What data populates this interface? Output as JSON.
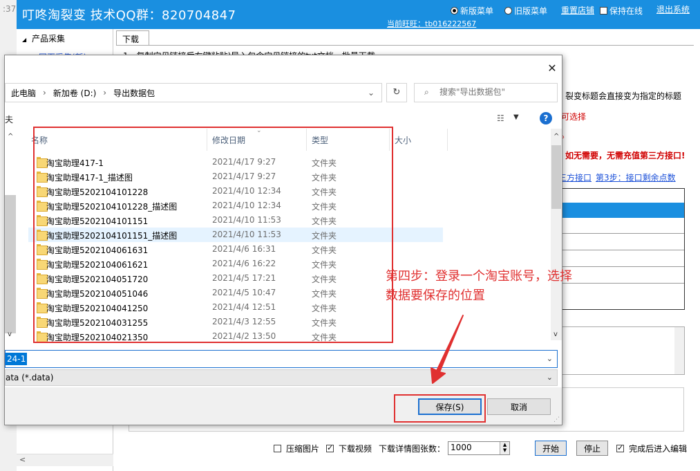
{
  "app": {
    "title": "叮咚淘裂变  技术QQ群：820704847",
    "left_edge_text": ":37",
    "menu_new": "新版菜单",
    "menu_old": "旧版菜单",
    "reset_shop": "重置店铺",
    "keep_online": "保持在线",
    "logout": "退出系统",
    "current_shop": "当前旺旺：tb016222567"
  },
  "sidebar": {
    "section": "产品采集",
    "link": "网页采集(新)"
  },
  "main": {
    "tab_label": "下载",
    "instruction": "1、复制宝贝链接后右键粘贴)导入包含宝贝链接的txt文档，批量下载",
    "hint_title": "裂变标题会直接变为指定的标题",
    "hint_select": "可选择",
    "hint_dot": "。",
    "hint_charge": "如无需要，无需充值第三方接口!",
    "step2_link": "三方接口",
    "step3_link": "第3步：接口剩余点数"
  },
  "bottom_bar": {
    "compress_label": "压缩图片",
    "video_label": "下载视频",
    "count_label": "下载详情图张数：",
    "count_value": "1000",
    "start_label": "开始",
    "stop_label": "停止",
    "edit_after_label": "完成后进入编辑"
  },
  "dialog": {
    "close_glyph": "✕",
    "breadcrumbs": [
      "此电脑",
      "新加卷 (D:)",
      "导出数据包"
    ],
    "search_placeholder": "搜索\"导出数据包\"",
    "toolbar_cut": "夫",
    "columns": {
      "name": "名称",
      "date": "修改日期",
      "type": "类型",
      "size": "大小"
    },
    "files": [
      {
        "name": "淘宝助理417-1",
        "date": "2021/4/17 9:27",
        "type": "文件夹"
      },
      {
        "name": "淘宝助理417-1_描述图",
        "date": "2021/4/17 9:27",
        "type": "文件夹"
      },
      {
        "name": "淘宝助理5202104101228",
        "date": "2021/4/10 12:34",
        "type": "文件夹"
      },
      {
        "name": "淘宝助理5202104101228_描述图",
        "date": "2021/4/10 12:34",
        "type": "文件夹"
      },
      {
        "name": "淘宝助理5202104101151",
        "date": "2021/4/10 11:53",
        "type": "文件夹"
      },
      {
        "name": "淘宝助理5202104101151_描述图",
        "date": "2021/4/10 11:53",
        "type": "文件夹"
      },
      {
        "name": "淘宝助理5202104061631",
        "date": "2021/4/6 16:31",
        "type": "文件夹"
      },
      {
        "name": "淘宝助理5202104061621",
        "date": "2021/4/6 16:22",
        "type": "文件夹"
      },
      {
        "name": "淘宝助理5202104051720",
        "date": "2021/4/5 17:21",
        "type": "文件夹"
      },
      {
        "name": "淘宝助理5202104051046",
        "date": "2021/4/5 10:47",
        "type": "文件夹"
      },
      {
        "name": "淘宝助理5202104041250",
        "date": "2021/4/4 12:51",
        "type": "文件夹"
      },
      {
        "name": "淘宝助理5202104031255",
        "date": "2021/4/3 12:55",
        "type": "文件夹"
      },
      {
        "name": "淘宝助理5202104021350",
        "date": "2021/4/2 13:50",
        "type": "文件夹"
      }
    ],
    "highlighted_index": 5,
    "file_name_value": "24-1",
    "file_type_value": "ata (*.data)",
    "save_label": "保存(S)",
    "cancel_label": "取消"
  },
  "annotation": {
    "line1": "第四步：登录一个淘宝账号，选择",
    "line2": "数据要保存的位置",
    "color": "#e03030"
  }
}
